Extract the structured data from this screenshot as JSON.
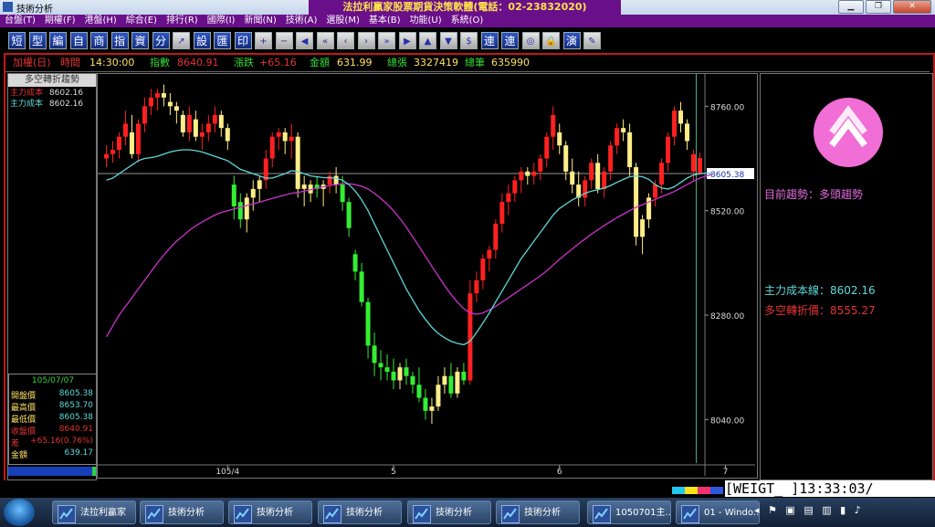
{
  "window": {
    "title": "技術分析",
    "banner": "法拉利贏家股票期貨決策軟體(電話：02-23832020)",
    "buttons": [
      "▁",
      "❐",
      "✕"
    ]
  },
  "menu": [
    "台盤(T)",
    "期權(F)",
    "港盤(H)",
    "綜合(E)",
    "排行(R)",
    "國際(I)",
    "新聞(N)",
    "技術(A)",
    "選股(M)",
    "基本(B)",
    "功能(U)",
    "系統(O)"
  ],
  "toolbar": {
    "text_buttons": [
      "短",
      "型",
      "編",
      "自",
      "商",
      "指",
      "資",
      "分"
    ],
    "text_buttons2": [
      "設",
      "匯",
      "印"
    ],
    "icon_buttons": [
      "+",
      "−",
      "◀",
      "«",
      "‹",
      "›",
      "»",
      "▶",
      "▲",
      "▼",
      "$"
    ],
    "text_buttons3": [
      "連",
      "連"
    ],
    "icon_buttons2": [
      "◎",
      "🔒"
    ],
    "text_buttons4": [
      "演"
    ],
    "icon_buttons3": [
      "✎"
    ]
  },
  "infobar": {
    "mode": "加權(日)",
    "time_label": "時間",
    "time": "14:30:00",
    "index_label": "指數",
    "index": "8640.91",
    "change_label": "漲跌",
    "change": "+65.16",
    "amount_label": "金額",
    "amount": "631.99",
    "total_sheets_label": "總張",
    "total_sheets": "3327419",
    "total_trades_label": "總筆",
    "total_trades": "635990"
  },
  "left_panel": {
    "title": "多空轉折趨勢",
    "rows": [
      {
        "label": "主力成本",
        "value": "8602.16"
      },
      {
        "label": "主力成本",
        "value": "8602.16"
      }
    ],
    "date": "105/07/07",
    "stats": [
      {
        "label": "開盤價",
        "value": "8605.38"
      },
      {
        "label": "最高價",
        "value": "8653.70"
      },
      {
        "label": "最低價",
        "value": "8605.38"
      },
      {
        "label": "收盤價",
        "value": "8640.91"
      },
      {
        "label": "差",
        "value": "+65.16(0.76%)"
      },
      {
        "label": "金額",
        "value": "639.17"
      }
    ]
  },
  "right_panel": {
    "trend": "目前趨勢：多頭趨勢",
    "cost_line": "主力成本線：8602.16",
    "pivot_price": "多空轉折價：8555.27"
  },
  "colors": {
    "up": "#ff2020",
    "down": "#33ee33",
    "weak_up": "#ffee88",
    "ma_cyan": "#5fd8d8",
    "ma_magenta": "#cc33cc",
    "accent_purple": "#6a0f8a"
  },
  "status": {
    "clock": "[WEIGT_ ]13:33:03/"
  },
  "taskbar": {
    "items": [
      "法拉利贏家",
      "技術分析",
      "技術分析",
      "技術分析",
      "技術分析",
      "技術分析",
      "1050701主...",
      "01 - Windo..."
    ]
  },
  "chart_data": {
    "type": "candlestick",
    "y_ticks": [
      "8760.00",
      "8520.00",
      "8280.00",
      "8040.00"
    ],
    "y_range": [
      7940,
      8830
    ],
    "current_price_label": "8605.38",
    "current_price": 8605.38,
    "x_labels": [
      "105/4",
      "5",
      "6",
      "7"
    ],
    "x_label_index": [
      19,
      45,
      71,
      97
    ],
    "candles": [
      [
        8640,
        8670,
        8620,
        8650
      ],
      [
        8650,
        8680,
        8630,
        8660
      ],
      [
        8660,
        8700,
        8640,
        8690
      ],
      [
        8690,
        8750,
        8670,
        8720
      ],
      [
        8700,
        8740,
        8640,
        8650
      ],
      [
        8650,
        8730,
        8630,
        8720
      ],
      [
        8720,
        8780,
        8700,
        8760
      ],
      [
        8760,
        8800,
        8740,
        8780
      ],
      [
        8780,
        8800,
        8750,
        8790
      ],
      [
        8790,
        8810,
        8760,
        8780
      ],
      [
        8770,
        8790,
        8740,
        8760
      ],
      [
        8760,
        8770,
        8720,
        8750
      ],
      [
        8740,
        8750,
        8690,
        8700
      ],
      [
        8700,
        8760,
        8680,
        8740
      ],
      [
        8730,
        8750,
        8680,
        8690
      ],
      [
        8690,
        8720,
        8660,
        8700
      ],
      [
        8700,
        8740,
        8680,
        8720
      ],
      [
        8720,
        8760,
        8700,
        8740
      ],
      [
        8740,
        8750,
        8690,
        8710
      ],
      [
        8710,
        8720,
        8660,
        8680
      ],
      [
        8580,
        8600,
        8500,
        8530
      ],
      [
        8540,
        8560,
        8480,
        8500
      ],
      [
        8500,
        8560,
        8470,
        8550
      ],
      [
        8550,
        8590,
        8520,
        8570
      ],
      [
        8570,
        8600,
        8540,
        8590
      ],
      [
        8590,
        8660,
        8570,
        8640
      ],
      [
        8640,
        8700,
        8620,
        8690
      ],
      [
        8690,
        8710,
        8660,
        8700
      ],
      [
        8700,
        8710,
        8650,
        8680
      ],
      [
        8680,
        8720,
        8640,
        8690
      ],
      [
        8690,
        8700,
        8550,
        8570
      ],
      [
        8570,
        8600,
        8530,
        8580
      ],
      [
        8560,
        8590,
        8540,
        8580
      ],
      [
        8580,
        8600,
        8550,
        8570
      ],
      [
        8570,
        8590,
        8530,
        8580
      ],
      [
        8580,
        8610,
        8560,
        8600
      ],
      [
        8600,
        8620,
        8560,
        8580
      ],
      [
        8580,
        8600,
        8520,
        8540
      ],
      [
        8540,
        8550,
        8460,
        8480
      ],
      [
        8420,
        8430,
        8360,
        8380
      ],
      [
        8380,
        8400,
        8300,
        8310
      ],
      [
        8310,
        8320,
        8180,
        8210
      ],
      [
        8210,
        8240,
        8140,
        8170
      ],
      [
        8170,
        8200,
        8130,
        8160
      ],
      [
        8160,
        8190,
        8130,
        8150
      ],
      [
        8150,
        8180,
        8110,
        8130
      ],
      [
        8130,
        8170,
        8110,
        8160
      ],
      [
        8160,
        8180,
        8120,
        8140
      ],
      [
        8140,
        8150,
        8100,
        8120
      ],
      [
        8120,
        8160,
        8080,
        8090
      ],
      [
        8090,
        8110,
        8040,
        8060
      ],
      [
        8060,
        8090,
        8030,
        8070
      ],
      [
        8070,
        8140,
        8060,
        8120
      ],
      [
        8120,
        8160,
        8100,
        8140
      ],
      [
        8140,
        8170,
        8090,
        8100
      ],
      [
        8100,
        8160,
        8090,
        8150
      ],
      [
        8150,
        8170,
        8120,
        8130
      ],
      [
        8130,
        8360,
        8120,
        8330
      ],
      [
        8330,
        8380,
        8310,
        8360
      ],
      [
        8360,
        8420,
        8340,
        8410
      ],
      [
        8410,
        8440,
        8380,
        8430
      ],
      [
        8430,
        8500,
        8410,
        8490
      ],
      [
        8490,
        8560,
        8470,
        8540
      ],
      [
        8540,
        8580,
        8510,
        8560
      ],
      [
        8560,
        8600,
        8540,
        8590
      ],
      [
        8590,
        8620,
        8560,
        8610
      ],
      [
        8610,
        8620,
        8580,
        8600
      ],
      [
        8600,
        8630,
        8580,
        8610
      ],
      [
        8610,
        8650,
        8590,
        8640
      ],
      [
        8640,
        8700,
        8620,
        8690
      ],
      [
        8690,
        8760,
        8660,
        8740
      ],
      [
        8700,
        8720,
        8650,
        8670
      ],
      [
        8670,
        8680,
        8590,
        8610
      ],
      [
        8610,
        8640,
        8560,
        8580
      ],
      [
        8580,
        8610,
        8530,
        8550
      ],
      [
        8550,
        8600,
        8530,
        8590
      ],
      [
        8590,
        8640,
        8570,
        8630
      ],
      [
        8630,
        8650,
        8560,
        8570
      ],
      [
        8570,
        8620,
        8550,
        8610
      ],
      [
        8610,
        8680,
        8590,
        8670
      ],
      [
        8670,
        8720,
        8650,
        8710
      ],
      [
        8710,
        8730,
        8680,
        8700
      ],
      [
        8700,
        8720,
        8600,
        8620
      ],
      [
        8620,
        8630,
        8440,
        8460
      ],
      [
        8460,
        8510,
        8420,
        8500
      ],
      [
        8500,
        8560,
        8480,
        8550
      ],
      [
        8550,
        8590,
        8530,
        8580
      ],
      [
        8580,
        8640,
        8560,
        8630
      ],
      [
        8630,
        8700,
        8610,
        8690
      ],
      [
        8690,
        8760,
        8670,
        8750
      ],
      [
        8750,
        8770,
        8700,
        8720
      ],
      [
        8720,
        8730,
        8660,
        8680
      ],
      [
        8610,
        8660,
        8590,
        8650
      ],
      [
        8605.38,
        8653.7,
        8605.38,
        8640.91
      ]
    ],
    "ma_cyan": [
      8590,
      8595,
      8605,
      8615,
      8625,
      8635,
      8640,
      8642,
      8645,
      8650,
      8655,
      8658,
      8660,
      8660,
      8658,
      8655,
      8650,
      8645,
      8640,
      8635,
      8625,
      8615,
      8610,
      8605,
      8600,
      8595,
      8595,
      8600,
      8605,
      8612,
      8610,
      8605,
      8600,
      8598,
      8596,
      8596,
      8594,
      8590,
      8580,
      8565,
      8545,
      8520,
      8490,
      8460,
      8430,
      8400,
      8370,
      8340,
      8315,
      8290,
      8270,
      8252,
      8238,
      8228,
      8220,
      8215,
      8212,
      8220,
      8240,
      8262,
      8285,
      8310,
      8335,
      8360,
      8385,
      8410,
      8430,
      8450,
      8470,
      8490,
      8510,
      8525,
      8535,
      8545,
      8552,
      8560,
      8565,
      8568,
      8572,
      8578,
      8585,
      8592,
      8598,
      8600,
      8598,
      8592,
      8580,
      8572,
      8570,
      8575,
      8585,
      8595,
      8602,
      8605,
      8606,
      8606
    ],
    "ma_magenta": [
      8230,
      8255,
      8280,
      8300,
      8320,
      8340,
      8360,
      8380,
      8400,
      8418,
      8435,
      8450,
      8462,
      8475,
      8485,
      8494,
      8502,
      8510,
      8516,
      8520,
      8524,
      8528,
      8532,
      8536,
      8540,
      8544,
      8548,
      8552,
      8556,
      8560,
      8562,
      8565,
      8568,
      8572,
      8575,
      8578,
      8580,
      8582,
      8582,
      8580,
      8576,
      8570,
      8560,
      8548,
      8535,
      8520,
      8502,
      8482,
      8460,
      8438,
      8415,
      8392,
      8370,
      8348,
      8328,
      8310,
      8295,
      8285,
      8282,
      8285,
      8292,
      8300,
      8310,
      8320,
      8330,
      8340,
      8350,
      8360,
      8370,
      8382,
      8395,
      8408,
      8420,
      8432,
      8444,
      8455,
      8466,
      8476,
      8486,
      8495,
      8504,
      8512,
      8520,
      8528,
      8534,
      8540,
      8546,
      8552,
      8558,
      8564,
      8572,
      8580,
      8588,
      8595,
      8600,
      8604
    ]
  }
}
